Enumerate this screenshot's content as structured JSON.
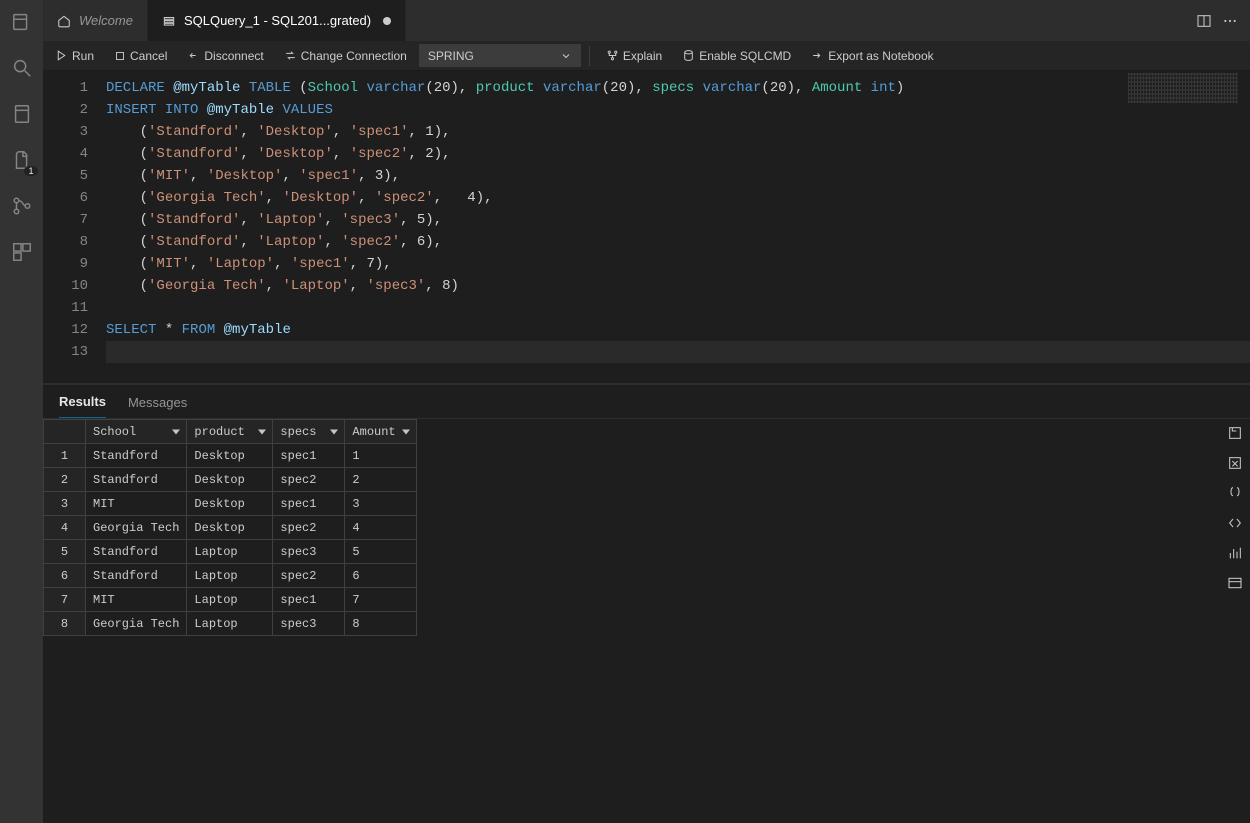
{
  "tabs": {
    "welcome": "Welcome",
    "sqlquery": "SQLQuery_1 - SQL201...grated)"
  },
  "toolbar": {
    "run": "Run",
    "cancel": "Cancel",
    "disconnect": "Disconnect",
    "change_connection": "Change Connection",
    "database": "SPRING",
    "explain": "Explain",
    "enable_sqlcmd": "Enable SQLCMD",
    "export_notebook": "Export as Notebook"
  },
  "code": {
    "lines": [
      "DECLARE @myTable TABLE (School varchar(20), product varchar(20), specs varchar(20), Amount int)",
      "INSERT INTO @myTable VALUES",
      "    ('Standford', 'Desktop', 'spec1', 1),",
      "    ('Standford', 'Desktop', 'spec2', 2),",
      "    ('MIT', 'Desktop', 'spec1', 3),",
      "    ('Georgia Tech', 'Desktop', 'spec2',   4),",
      "    ('Standford', 'Laptop', 'spec3', 5),",
      "    ('Standford', 'Laptop', 'spec2', 6),",
      "    ('MIT', 'Laptop', 'spec1', 7),",
      "    ('Georgia Tech', 'Laptop', 'spec3', 8)",
      "",
      "SELECT * FROM @myTable",
      ""
    ]
  },
  "panel": {
    "tab_results": "Results",
    "tab_messages": "Messages",
    "columns": [
      "School",
      "product",
      "specs",
      "Amount"
    ],
    "rows": [
      {
        "n": "1",
        "School": "Standford",
        "product": "Desktop",
        "specs": "spec1",
        "Amount": "1"
      },
      {
        "n": "2",
        "School": "Standford",
        "product": "Desktop",
        "specs": "spec2",
        "Amount": "2"
      },
      {
        "n": "3",
        "School": "MIT",
        "product": "Desktop",
        "specs": "spec1",
        "Amount": "3"
      },
      {
        "n": "4",
        "School": "Georgia Tech",
        "product": "Desktop",
        "specs": "spec2",
        "Amount": "4"
      },
      {
        "n": "5",
        "School": "Standford",
        "product": "Laptop",
        "specs": "spec3",
        "Amount": "5"
      },
      {
        "n": "6",
        "School": "Standford",
        "product": "Laptop",
        "specs": "spec2",
        "Amount": "6"
      },
      {
        "n": "7",
        "School": "MIT",
        "product": "Laptop",
        "specs": "spec1",
        "Amount": "7"
      },
      {
        "n": "8",
        "School": "Georgia Tech",
        "product": "Laptop",
        "specs": "spec3",
        "Amount": "8"
      }
    ]
  },
  "activity_badge": "1"
}
